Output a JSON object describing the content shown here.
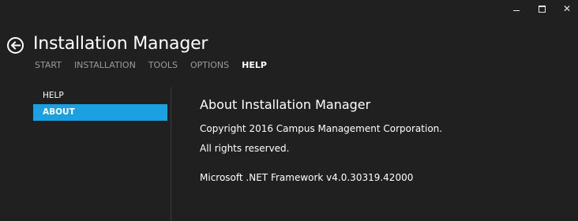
{
  "window": {
    "minimize_icon": "minimize-icon",
    "maximize_icon": "maximize-icon",
    "close_glyph": "✕"
  },
  "header": {
    "back_icon": "back-arrow-icon",
    "title": "Installation Manager"
  },
  "nav": {
    "tabs": [
      {
        "label": "START",
        "active": false
      },
      {
        "label": "INSTALLATION",
        "active": false
      },
      {
        "label": "TOOLS",
        "active": false
      },
      {
        "label": "OPTIONS",
        "active": false
      },
      {
        "label": "HELP",
        "active": true
      }
    ]
  },
  "sidebar": {
    "items": [
      {
        "label": "HELP",
        "active": false
      },
      {
        "label": "ABOUT",
        "active": true
      }
    ]
  },
  "about": {
    "title": "About Installation Manager",
    "copyright": "Copyright 2016 Campus Management Corporation.",
    "rights": "All rights reserved.",
    "framework": "Microsoft .NET Framework v4.0.30319.42000"
  },
  "colors": {
    "background": "#202020",
    "accent": "#1ba1e2",
    "muted_text": "#9a9a9a"
  }
}
